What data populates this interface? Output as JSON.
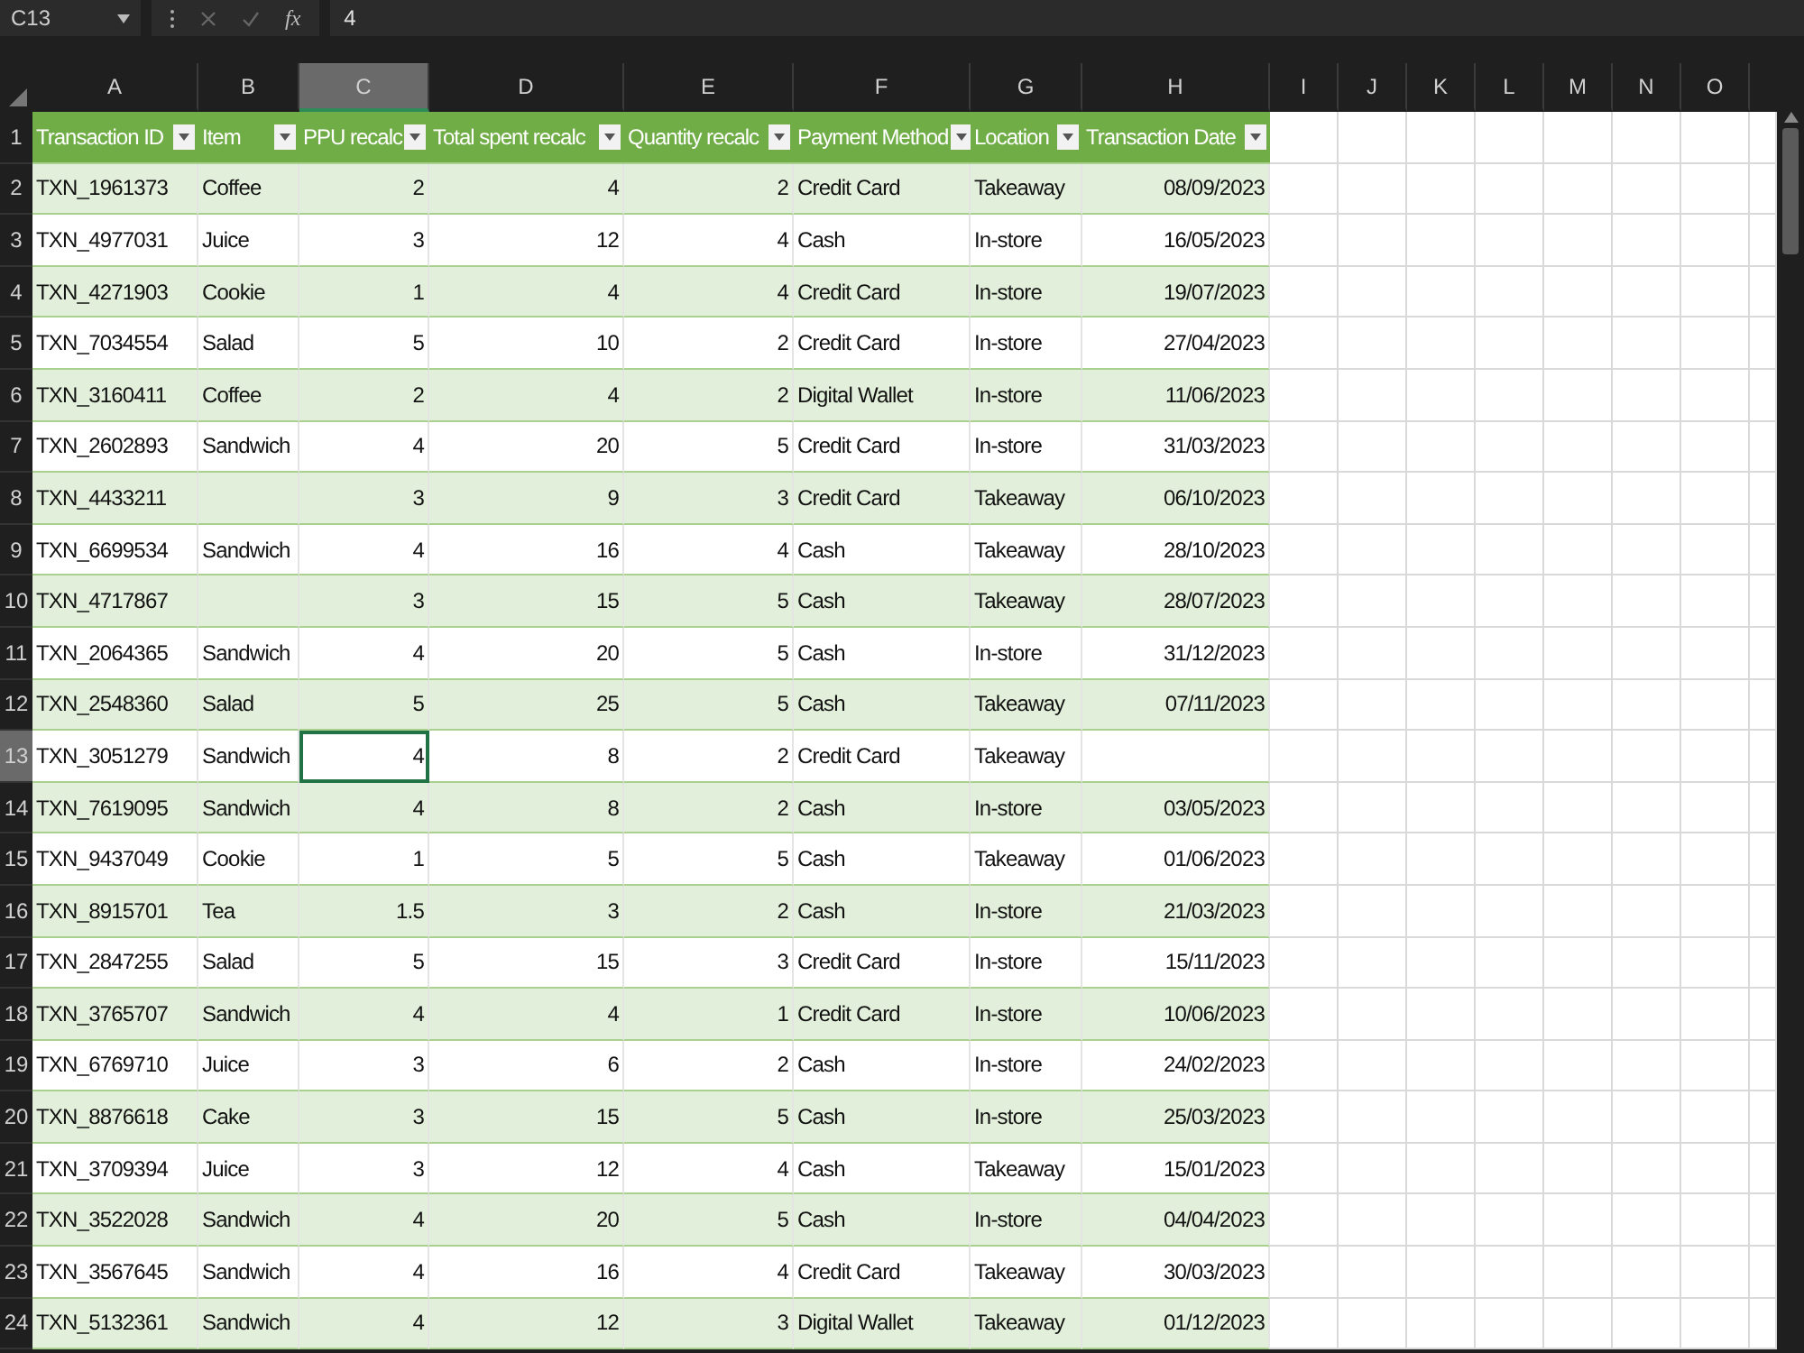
{
  "formula_bar": {
    "name_box": "C13",
    "function_label": "fx",
    "formula": "4"
  },
  "columns": [
    {
      "letter": "A",
      "selected": false
    },
    {
      "letter": "B",
      "selected": false
    },
    {
      "letter": "C",
      "selected": true
    },
    {
      "letter": "D",
      "selected": false
    },
    {
      "letter": "E",
      "selected": false
    },
    {
      "letter": "F",
      "selected": false
    },
    {
      "letter": "G",
      "selected": false
    },
    {
      "letter": "H",
      "selected": false
    },
    {
      "letter": "I",
      "selected": false
    },
    {
      "letter": "J",
      "selected": false
    },
    {
      "letter": "K",
      "selected": false
    },
    {
      "letter": "L",
      "selected": false
    },
    {
      "letter": "M",
      "selected": false
    },
    {
      "letter": "N",
      "selected": false
    },
    {
      "letter": "O",
      "selected": false
    }
  ],
  "table": {
    "headers": [
      {
        "label": "Transaction ID",
        "kind": "text"
      },
      {
        "label": "Item",
        "kind": "text"
      },
      {
        "label": "PPU recalc",
        "kind": "number"
      },
      {
        "label": "Total spent recalc",
        "kind": "number"
      },
      {
        "label": "Quantity recalc",
        "kind": "number"
      },
      {
        "label": "Payment Method",
        "kind": "text"
      },
      {
        "label": "Location",
        "kind": "text"
      },
      {
        "label": "Transaction Date",
        "kind": "number"
      }
    ],
    "header_row_number": "1",
    "rows": [
      {
        "number": "2",
        "selected": false,
        "cells": [
          "TXN_1961373",
          "Coffee",
          "2",
          "4",
          "2",
          "Credit Card",
          "Takeaway",
          "08/09/2023"
        ]
      },
      {
        "number": "3",
        "selected": false,
        "cells": [
          "TXN_4977031",
          "Juice",
          "3",
          "12",
          "4",
          "Cash",
          "In-store",
          "16/05/2023"
        ]
      },
      {
        "number": "4",
        "selected": false,
        "cells": [
          "TXN_4271903",
          "Cookie",
          "1",
          "4",
          "4",
          "Credit Card",
          "In-store",
          "19/07/2023"
        ]
      },
      {
        "number": "5",
        "selected": false,
        "cells": [
          "TXN_7034554",
          "Salad",
          "5",
          "10",
          "2",
          "Credit Card",
          "In-store",
          "27/04/2023"
        ]
      },
      {
        "number": "6",
        "selected": false,
        "cells": [
          "TXN_3160411",
          "Coffee",
          "2",
          "4",
          "2",
          "Digital Wallet",
          "In-store",
          "11/06/2023"
        ]
      },
      {
        "number": "7",
        "selected": false,
        "cells": [
          "TXN_2602893",
          "Sandwich",
          "4",
          "20",
          "5",
          "Credit Card",
          "In-store",
          "31/03/2023"
        ]
      },
      {
        "number": "8",
        "selected": false,
        "cells": [
          "TXN_4433211",
          null,
          "3",
          "9",
          "3",
          "Credit Card",
          "Takeaway",
          "06/10/2023"
        ]
      },
      {
        "number": "9",
        "selected": false,
        "cells": [
          "TXN_6699534",
          "Sandwich",
          "4",
          "16",
          "4",
          "Cash",
          "Takeaway",
          "28/10/2023"
        ]
      },
      {
        "number": "10",
        "selected": false,
        "cells": [
          "TXN_4717867",
          null,
          "3",
          "15",
          "5",
          "Cash",
          "Takeaway",
          "28/07/2023"
        ]
      },
      {
        "number": "11",
        "selected": false,
        "cells": [
          "TXN_2064365",
          "Sandwich",
          "4",
          "20",
          "5",
          "Cash",
          "In-store",
          "31/12/2023"
        ]
      },
      {
        "number": "12",
        "selected": false,
        "cells": [
          "TXN_2548360",
          "Salad",
          "5",
          "25",
          "5",
          "Cash",
          "Takeaway",
          "07/11/2023"
        ]
      },
      {
        "number": "13",
        "selected": true,
        "cells": [
          "TXN_3051279",
          "Sandwich",
          "4",
          "8",
          "2",
          "Credit Card",
          "Takeaway",
          null
        ]
      },
      {
        "number": "14",
        "selected": false,
        "cells": [
          "TXN_7619095",
          "Sandwich",
          "4",
          "8",
          "2",
          "Cash",
          "In-store",
          "03/05/2023"
        ]
      },
      {
        "number": "15",
        "selected": false,
        "cells": [
          "TXN_9437049",
          "Cookie",
          "1",
          "5",
          "5",
          "Cash",
          "Takeaway",
          "01/06/2023"
        ]
      },
      {
        "number": "16",
        "selected": false,
        "cells": [
          "TXN_8915701",
          "Tea",
          "1.5",
          "3",
          "2",
          "Cash",
          "In-store",
          "21/03/2023"
        ]
      },
      {
        "number": "17",
        "selected": false,
        "cells": [
          "TXN_2847255",
          "Salad",
          "5",
          "15",
          "3",
          "Credit Card",
          "In-store",
          "15/11/2023"
        ]
      },
      {
        "number": "18",
        "selected": false,
        "cells": [
          "TXN_3765707",
          "Sandwich",
          "4",
          "4",
          "1",
          "Credit Card",
          "In-store",
          "10/06/2023"
        ]
      },
      {
        "number": "19",
        "selected": false,
        "cells": [
          "TXN_6769710",
          "Juice",
          "3",
          "6",
          "2",
          "Cash",
          "In-store",
          "24/02/2023"
        ]
      },
      {
        "number": "20",
        "selected": false,
        "cells": [
          "TXN_8876618",
          "Cake",
          "3",
          "15",
          "5",
          "Cash",
          "In-store",
          "25/03/2023"
        ]
      },
      {
        "number": "21",
        "selected": false,
        "cells": [
          "TXN_3709394",
          "Juice",
          "3",
          "12",
          "4",
          "Cash",
          "Takeaway",
          "15/01/2023"
        ]
      },
      {
        "number": "22",
        "selected": false,
        "cells": [
          "TXN_3522028",
          "Sandwich",
          "4",
          "20",
          "5",
          "Cash",
          "In-store",
          "04/04/2023"
        ]
      },
      {
        "number": "23",
        "selected": false,
        "cells": [
          "TXN_3567645",
          "Sandwich",
          "4",
          "16",
          "4",
          "Credit Card",
          "Takeaway",
          "30/03/2023"
        ]
      },
      {
        "number": "24",
        "selected": false,
        "cells": [
          "TXN_5132361",
          "Sandwich",
          "4",
          "12",
          "3",
          "Digital Wallet",
          "Takeaway",
          "01/12/2023"
        ]
      }
    ]
  }
}
